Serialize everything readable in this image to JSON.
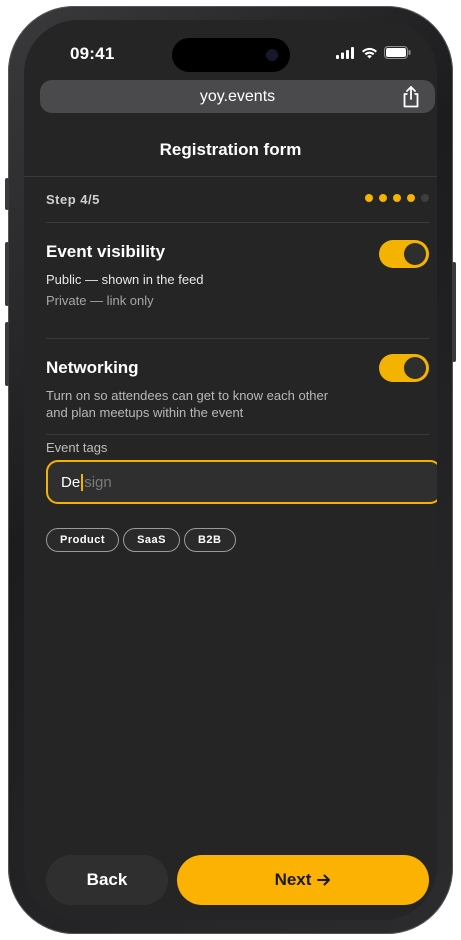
{
  "status_bar": {
    "time": "09:41"
  },
  "browser": {
    "url": "yoy.events"
  },
  "form": {
    "title": "Registration form",
    "step_label": "Step 4/5",
    "steps_total": 5,
    "steps_completed": 4
  },
  "visibility": {
    "title": "Event visibility",
    "public_text": "Public — shown in the feed",
    "private_text": "Private — link only",
    "enabled": true
  },
  "networking": {
    "title": "Networking",
    "description": "Turn on so attendees can get to know each other and plan meetups within the event",
    "enabled": true
  },
  "tags": {
    "label": "Event tags",
    "typed_value": "De",
    "autocomplete": "sign",
    "chips": [
      "Product",
      "SaaS",
      "B2B"
    ]
  },
  "footer": {
    "back_label": "Back",
    "next_label": "Next"
  },
  "colors": {
    "accent": "#f5b301",
    "background": "#252525",
    "text": "#ffffff"
  },
  "icons": {
    "next_arrow": "arrow-right-icon",
    "share": "share-icon"
  }
}
